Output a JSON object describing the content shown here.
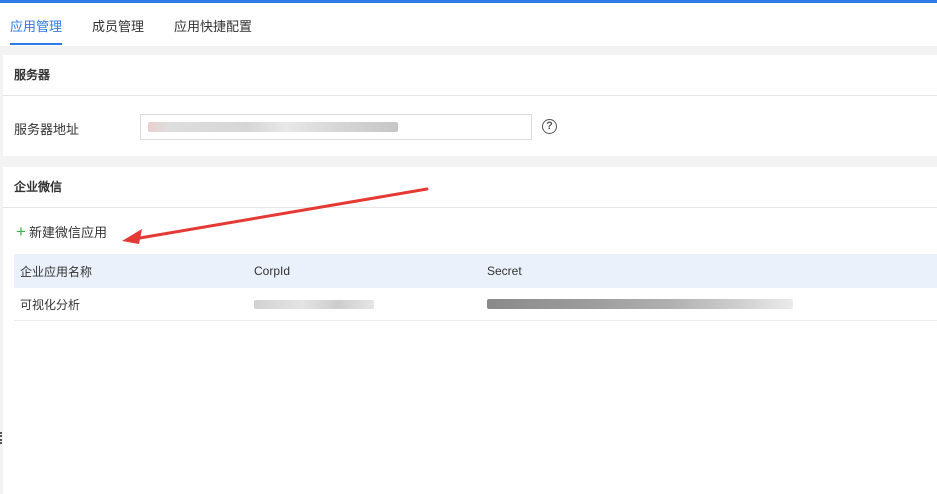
{
  "tabs": [
    {
      "label": "应用管理",
      "active": true
    },
    {
      "label": "成员管理",
      "active": false
    },
    {
      "label": "应用快捷配置",
      "active": false
    }
  ],
  "server_section": {
    "title": "服务器",
    "address_label": "服务器地址",
    "address_value": "",
    "help_icon": "question-circle-icon"
  },
  "wechat_section": {
    "title": "企业微信",
    "add_button": {
      "label": "新建微信应用",
      "icon": "plus-icon"
    },
    "table": {
      "headers": [
        "企业应用名称",
        "CorpId",
        "Secret"
      ],
      "rows": [
        {
          "name": "可视化分析",
          "corpid": "",
          "secret": ""
        }
      ]
    }
  },
  "colors": {
    "accent": "#2f7be6",
    "plus": "#3bb54a",
    "annotation_arrow": "#e53935",
    "table_header_bg": "#eaf1fb"
  }
}
